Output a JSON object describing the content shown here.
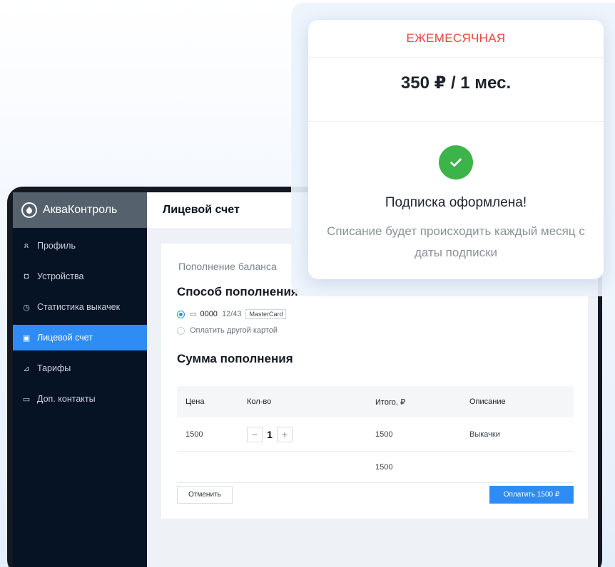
{
  "app": {
    "name": "АкваКонтроль"
  },
  "sidebar": {
    "items": [
      {
        "label": "Профиль",
        "icon": "user-icon",
        "glyph": "ጸ"
      },
      {
        "label": "Устройства",
        "icon": "device-icon",
        "glyph": "◘"
      },
      {
        "label": "Статистика выкачек",
        "icon": "gauge-icon",
        "glyph": "◷"
      },
      {
        "label": "Лицевой счет",
        "icon": "account-icon",
        "glyph": "▣",
        "active": true
      },
      {
        "label": "Тарифы",
        "icon": "chart-icon",
        "glyph": "⊿"
      },
      {
        "label": "Доп. контакты",
        "icon": "contacts-icon",
        "glyph": "▭"
      }
    ]
  },
  "header": {
    "title": "Лицевой счет"
  },
  "form": {
    "subtitle": "Пополнение баланса",
    "method_heading": "Способ пополнения",
    "card_number": "0000",
    "card_expiry": "12/43",
    "card_brand": "MasterCard",
    "other_card_label": "Оплатить другой картой",
    "sum_heading": "Сумма пополнения",
    "table": {
      "headers": [
        "Цена",
        "Кол-во",
        "Итого, ₽",
        "Описание"
      ],
      "row": {
        "price": "1500",
        "quantity": "1",
        "total": "1500",
        "description": "Выкачки"
      },
      "total": "1500"
    },
    "cancel_label": "Отменить",
    "pay_label": "Оплатить 1500 ₽"
  },
  "popup": {
    "plan": "ЕЖЕМЕСЯЧНАЯ",
    "price": "350 ₽ / 1 мес.",
    "title": "Подписка оформлена!",
    "description": "Списание будет происходить каждый месяц с даты подписки"
  },
  "colors": {
    "accent": "#2f8cf5",
    "sidebar_bg": "#061325",
    "plan_red": "#e8463f",
    "success_green": "#3cb44a"
  }
}
